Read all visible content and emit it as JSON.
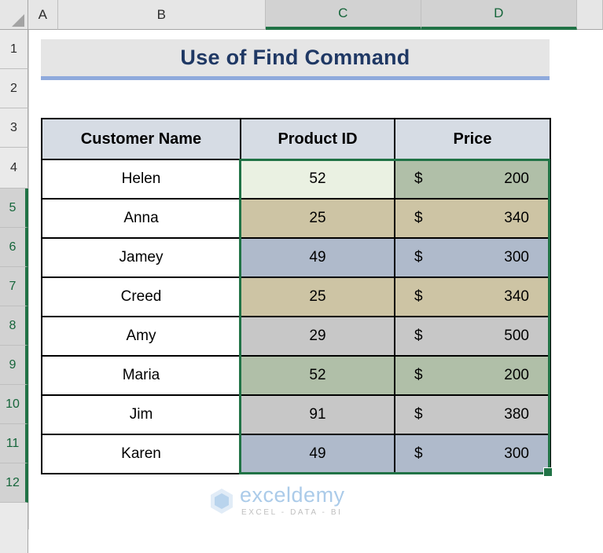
{
  "app": {
    "name": "Microsoft Excel",
    "selection_range": "C5:D12",
    "active_cell": "C5"
  },
  "column_headers": [
    {
      "label": "A",
      "selected": false
    },
    {
      "label": "B",
      "selected": false
    },
    {
      "label": "C",
      "selected": true
    },
    {
      "label": "D",
      "selected": true
    },
    {
      "label": "",
      "selected": false
    }
  ],
  "row_headers": [
    {
      "label": "1",
      "selected": false
    },
    {
      "label": "2",
      "selected": false
    },
    {
      "label": "3",
      "selected": false
    },
    {
      "label": "4",
      "selected": false
    },
    {
      "label": "5",
      "selected": true
    },
    {
      "label": "6",
      "selected": true
    },
    {
      "label": "7",
      "selected": true
    },
    {
      "label": "8",
      "selected": true
    },
    {
      "label": "9",
      "selected": true
    },
    {
      "label": "10",
      "selected": true
    },
    {
      "label": "11",
      "selected": true
    },
    {
      "label": "12",
      "selected": true
    }
  ],
  "title": {
    "text": "Use of Find Command",
    "text_color": "#1F3864",
    "background": "#E5E5E5",
    "underline_color": "#8FAADC"
  },
  "table": {
    "headers": [
      "Customer Name",
      "Product ID",
      "Price"
    ],
    "header_background": "#D6DCE4",
    "currency_symbol": "$",
    "rows": [
      {
        "name": "Helen",
        "product_id": "52",
        "price": "200",
        "pid_fill": "#EAF1E2",
        "price_fill": "#B0BFA8"
      },
      {
        "name": "Anna",
        "product_id": "25",
        "price": "340",
        "pid_fill": "#CDC4A4",
        "price_fill": "#CDC4A4"
      },
      {
        "name": "Jamey",
        "product_id": "49",
        "price": "300",
        "pid_fill": "#AFBACB",
        "price_fill": "#AFBACB"
      },
      {
        "name": "Creed",
        "product_id": "25",
        "price": "340",
        "pid_fill": "#CDC4A4",
        "price_fill": "#CDC4A4"
      },
      {
        "name": "Amy",
        "product_id": "29",
        "price": "500",
        "pid_fill": "#C7C7C7",
        "price_fill": "#C7C7C7"
      },
      {
        "name": "Maria",
        "product_id": "52",
        "price": "200",
        "pid_fill": "#B0BFA8",
        "price_fill": "#B0BFA8"
      },
      {
        "name": "Jim",
        "product_id": "91",
        "price": "380",
        "pid_fill": "#C7C7C7",
        "price_fill": "#C7C7C7"
      },
      {
        "name": "Karen",
        "product_id": "49",
        "price": "300",
        "pid_fill": "#AFBACB",
        "price_fill": "#AFBACB"
      }
    ]
  },
  "selection": {
    "border_color": "#217346",
    "fill_handle_color": "#217346"
  },
  "watermark": {
    "name": "exceldemy",
    "tagline": "EXCEL - DATA - BI",
    "name_color": "#9DC3E6"
  }
}
